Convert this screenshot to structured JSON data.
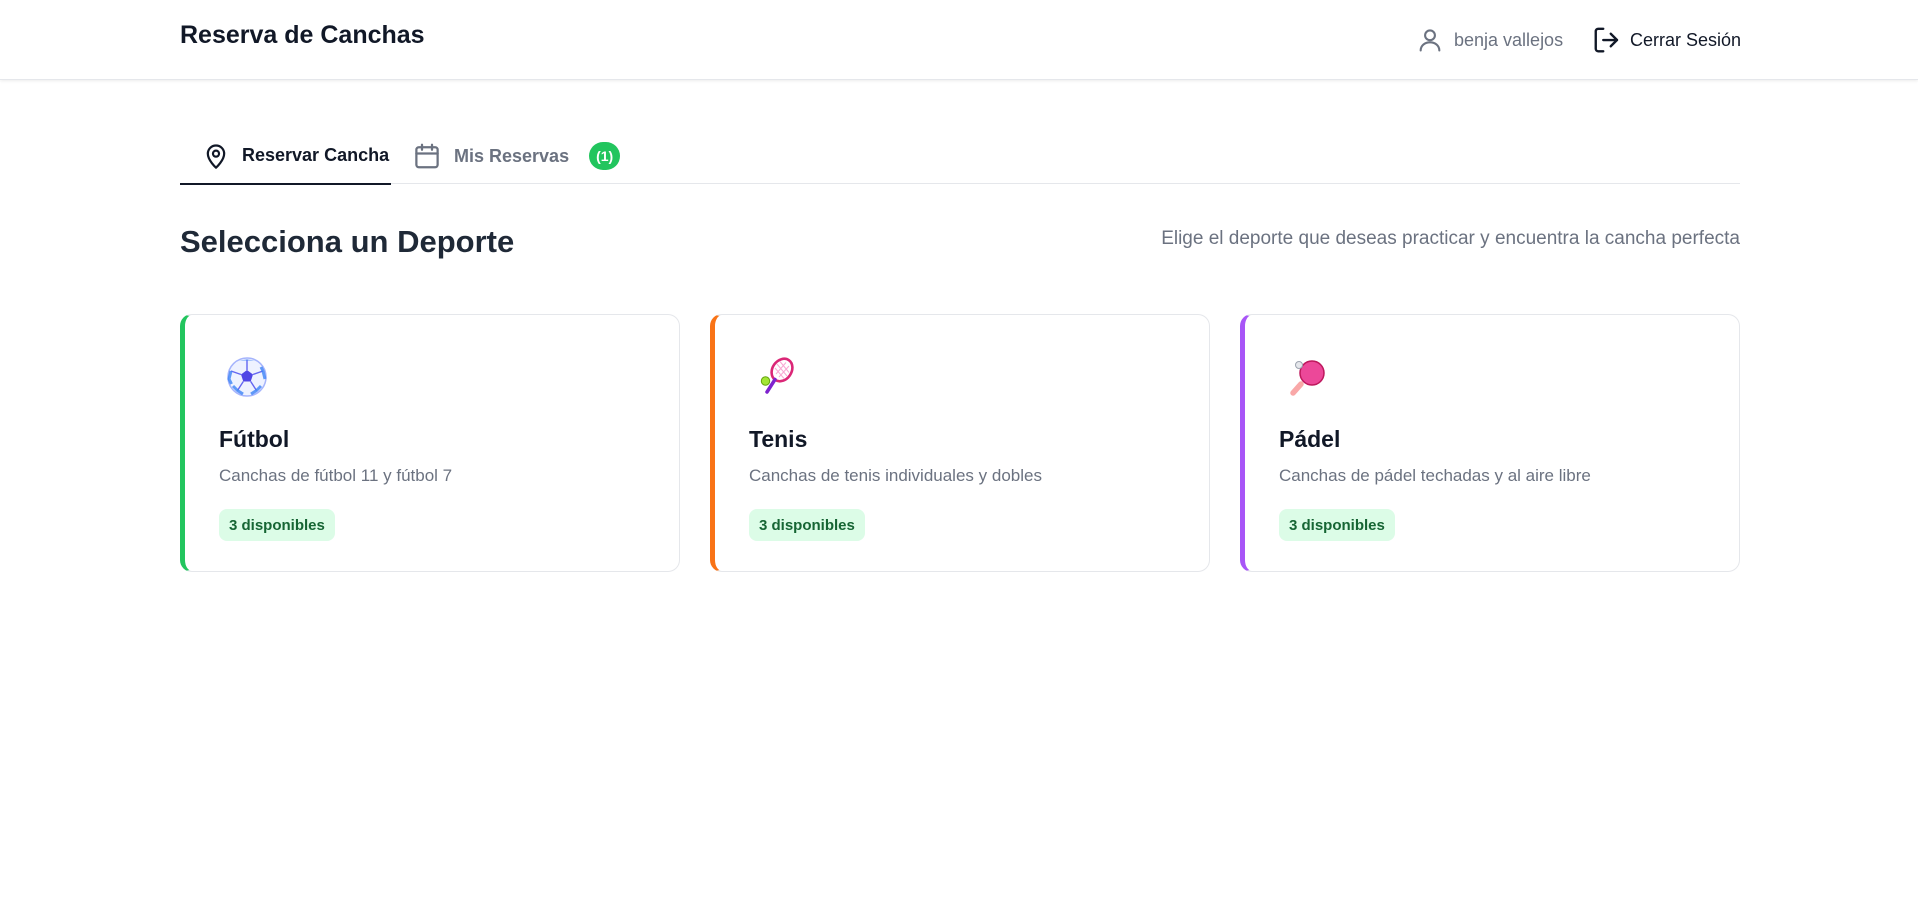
{
  "header": {
    "title": "Reserva de Canchas",
    "user_name": "benja vallejos",
    "logout_label": "Cerrar Sesión"
  },
  "tabs": [
    {
      "label": "Reservar Cancha",
      "icon": "map-pin-icon",
      "active": true
    },
    {
      "label": "Mis Reservas",
      "icon": "calendar-icon",
      "active": false,
      "badge": "(1)"
    }
  ],
  "section": {
    "title": "Selecciona un Deporte",
    "subtitle": "Elige el deporte que deseas practicar y encuentra la cancha perfecta"
  },
  "sports": [
    {
      "name": "Fútbol",
      "description": "Canchas de fútbol 11 y fútbol 7",
      "available": "3 disponibles",
      "accent": "#22c55e",
      "icon": "soccer-ball-icon"
    },
    {
      "name": "Tenis",
      "description": "Canchas de tenis individuales y dobles",
      "available": "3 disponibles",
      "accent": "#f97316",
      "icon": "tennis-racket-icon"
    },
    {
      "name": "Pádel",
      "description": "Canchas de pádel techadas y al aire libre",
      "available": "3 disponibles",
      "accent": "#a855f7",
      "icon": "paddle-icon"
    }
  ],
  "colors": {
    "success": "#22c55e",
    "badge_bg": "#dcfce7",
    "badge_text": "#166534",
    "muted_text": "#6b7280"
  }
}
